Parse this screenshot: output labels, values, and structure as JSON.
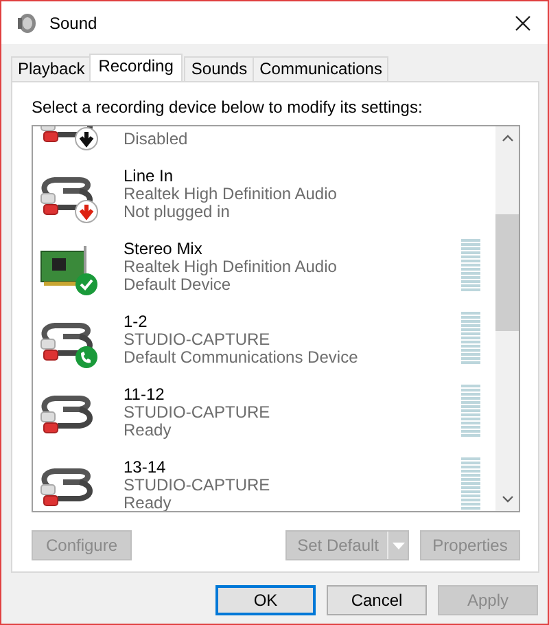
{
  "window": {
    "title": "Sound"
  },
  "tabs": [
    {
      "label": "Playback",
      "selected": false
    },
    {
      "label": "Recording",
      "selected": true
    },
    {
      "label": "Sounds",
      "selected": false
    },
    {
      "label": "Communications",
      "selected": false
    }
  ],
  "instruction": "Select a recording device below to modify its settings:",
  "devices": [
    {
      "status": "Disabled",
      "kind": "cable",
      "enabled": false,
      "plugged_in": true,
      "default": false,
      "communications_default": false
    },
    {
      "name": "Line In",
      "driver": "Realtek High Definition Audio",
      "status": "Not plugged in",
      "kind": "cable",
      "enabled": true,
      "plugged_in": false,
      "default": false,
      "communications_default": false
    },
    {
      "name": "Stereo Mix",
      "driver": "Realtek High Definition Audio",
      "status": "Default Device",
      "kind": "card",
      "enabled": true,
      "plugged_in": true,
      "default": true,
      "communications_default": false,
      "level": 0
    },
    {
      "name": "1-2",
      "driver": "STUDIO-CAPTURE",
      "status": "Default Communications Device",
      "kind": "cable",
      "enabled": true,
      "plugged_in": true,
      "default": false,
      "communications_default": true,
      "level": 0
    },
    {
      "name": "11-12",
      "driver": "STUDIO-CAPTURE",
      "status": "Ready",
      "kind": "cable",
      "enabled": true,
      "plugged_in": true,
      "default": false,
      "communications_default": false,
      "level": 0
    },
    {
      "name": "13-14",
      "driver": "STUDIO-CAPTURE",
      "status": "Ready",
      "kind": "cable",
      "enabled": true,
      "plugged_in": true,
      "default": false,
      "communications_default": false,
      "level": 0
    }
  ],
  "panel_buttons": [
    {
      "label": "Configure",
      "kind": "plain",
      "disabled": true
    },
    {
      "label": "Set Default",
      "kind": "split",
      "disabled": true
    },
    {
      "label": "Properties",
      "kind": "plain",
      "disabled": true
    }
  ],
  "dialog_buttons": [
    {
      "label": "OK",
      "default": true,
      "disabled": false
    },
    {
      "label": "Cancel",
      "default": false,
      "disabled": false
    },
    {
      "label": "Apply",
      "default": false,
      "disabled": true
    }
  ]
}
